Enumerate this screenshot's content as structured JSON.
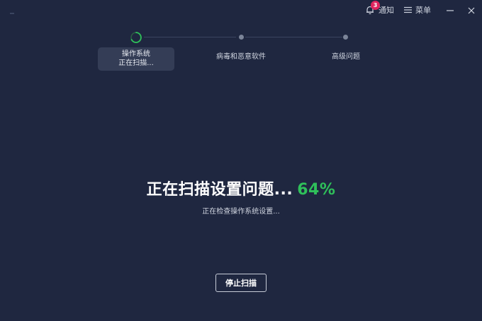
{
  "titlebar": {
    "notify_label": "通知",
    "notify_count": "3",
    "menu_label": "菜单",
    "icons": [
      "bell-icon",
      "hamburger-icon",
      "minimize-icon",
      "close-icon"
    ]
  },
  "stepper": {
    "steps": [
      {
        "label": "操作系统",
        "sublabel": "正在扫描...",
        "state": "active"
      },
      {
        "label": "病毒和恶意软件",
        "state": "pending"
      },
      {
        "label": "高级问题",
        "state": "pending"
      }
    ]
  },
  "scan": {
    "title": "正在扫描设置问题...",
    "percent": "64%",
    "progress": 0.64,
    "subtitle": "正在检查操作系统设置..."
  },
  "actions": {
    "stop_label": "停止扫描"
  },
  "colors": {
    "background": "#1f2740",
    "accent_green": "#2fc05a",
    "badge_red": "#e0245e",
    "step_card": "#343d56"
  }
}
